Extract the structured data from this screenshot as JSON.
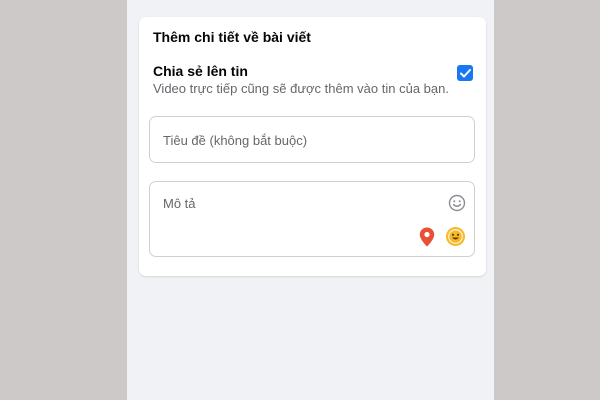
{
  "card": {
    "title": "Thêm chi tiết về bài viết",
    "share": {
      "label": "Chia sẻ lên tin",
      "description": "Video trực tiếp cũng sẽ được thêm vào tin của bạn.",
      "checked": true,
      "checkbox_color": "#1877f2"
    },
    "title_field": {
      "placeholder": "Tiêu đề (không bắt buộc)",
      "value": ""
    },
    "description_field": {
      "placeholder": "Mô tả",
      "value": ""
    },
    "icons": {
      "emoji_outline": "smile-outline-icon",
      "location": "location-pin-icon",
      "feeling": "smiling-emoji-icon"
    }
  },
  "colors": {
    "background_outer": "#cdc9c9",
    "background_app": "#f0f2f5",
    "accent": "#1877f2",
    "pin": "#e94f37",
    "emoji": "#f7b928"
  }
}
